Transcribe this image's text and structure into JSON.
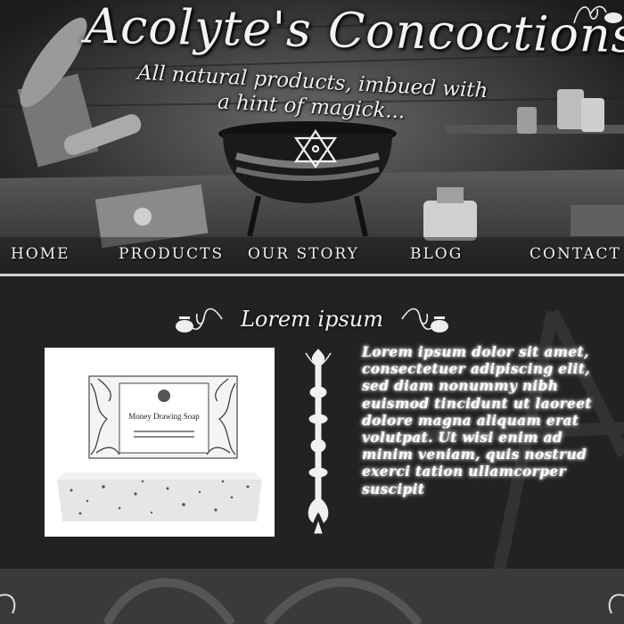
{
  "header": {
    "site_title": "Acolyte's Concoctions",
    "tagline": "All natural products, imbued with a hint of magick..."
  },
  "nav": {
    "items": [
      {
        "label": "Home"
      },
      {
        "label": "Products"
      },
      {
        "label": "Our Story"
      },
      {
        "label": "Blog"
      },
      {
        "label": "Contact"
      }
    ]
  },
  "featured": {
    "heading": "Lorem ipsum",
    "product": {
      "name": "Money Drawing Soap",
      "subtitle": "MADE WITH\nPURE BOTANICAL OILS"
    },
    "description": "Lorem ipsum dolor sit amet, consectetuer adipiscing elit, sed diam nonummy nibh euismod tincidunt ut laoreet dolore magna aliquam erat volutpat. Ut wisi enim ad minim veniam, quis nostrud exerci tation ullamcorper suscipit"
  },
  "icons": {
    "hero_emblem": "unicursal-hexagram-icon",
    "corner_ornament": "cauldron-flourish-icon",
    "heading_ornament": "cauldron-flourish-icon",
    "divider": "ornamental-divider"
  },
  "colors": {
    "background": "#222222",
    "text": "#ffffff",
    "nav_text": "#f0f0f0",
    "footer": "#3a3a3a"
  }
}
